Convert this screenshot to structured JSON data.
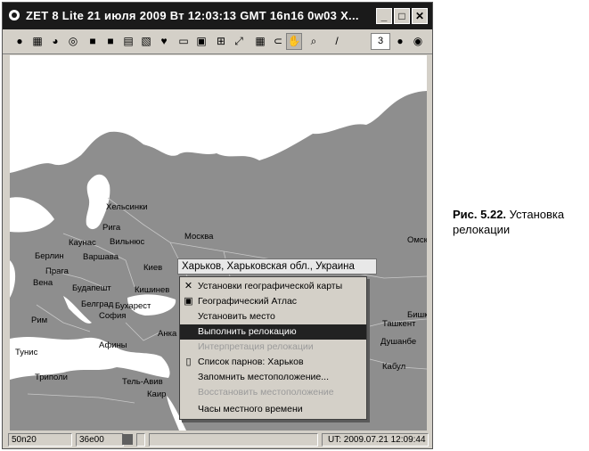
{
  "window": {
    "title": "ZET 8 Lite    21 июля 2009  Вт   12:03:13 GMT 16n16  0w03    X...",
    "minimize": "_",
    "maximize": "□",
    "close": "✕"
  },
  "toolbar": {
    "zoom_value": "3"
  },
  "map": {
    "cities": [
      "Хельсинки",
      "Рига",
      "Каунас",
      "Вильнюс",
      "Москва",
      "Омск",
      "Берлин",
      "Варшава",
      "Прага",
      "Вена",
      "Киев",
      "Будапешт",
      "Кишинев",
      "Белград",
      "Бухарест",
      "София",
      "Рим",
      "Анка",
      "Афины",
      "Тунис",
      "Триполи",
      "Тель-Авив",
      "Каир",
      "Ташкент",
      "Душанбе",
      "Кабул",
      "Бишк"
    ]
  },
  "context_menu": {
    "header": "Харьков, Харьковская обл., Украина",
    "items": [
      {
        "label": "Установки географической карты",
        "icon": "✕",
        "state": "normal"
      },
      {
        "label": "Географический Атлас",
        "icon": "▣",
        "state": "normal"
      },
      {
        "label": "Установить место",
        "icon": "",
        "state": "normal"
      },
      {
        "label": "Выполнить релокацию",
        "icon": "",
        "state": "highlighted"
      },
      {
        "label": "Интерпретация релокации",
        "icon": "",
        "state": "disabled"
      },
      {
        "label": "Список парнов: Харьков",
        "icon": "▯",
        "state": "normal"
      },
      {
        "label": "Запомнить местоположение...",
        "icon": "",
        "state": "normal"
      },
      {
        "label": "Восстановить местоположение",
        "icon": "",
        "state": "disabled"
      },
      {
        "label": "Часы местного времени",
        "icon": "",
        "state": "normal"
      }
    ]
  },
  "statusbar": {
    "lat": "50n20",
    "lon": "36e00",
    "ut": "UT: 2009.07.21 12:09:44"
  },
  "caption": {
    "label": "Рис. 5.22.",
    "text": " Установка релокации"
  },
  "colors": {
    "titlebar": "#1a1a1a",
    "land": "#8e8e8e",
    "water": "#ffffff",
    "highlight": "#222222"
  }
}
